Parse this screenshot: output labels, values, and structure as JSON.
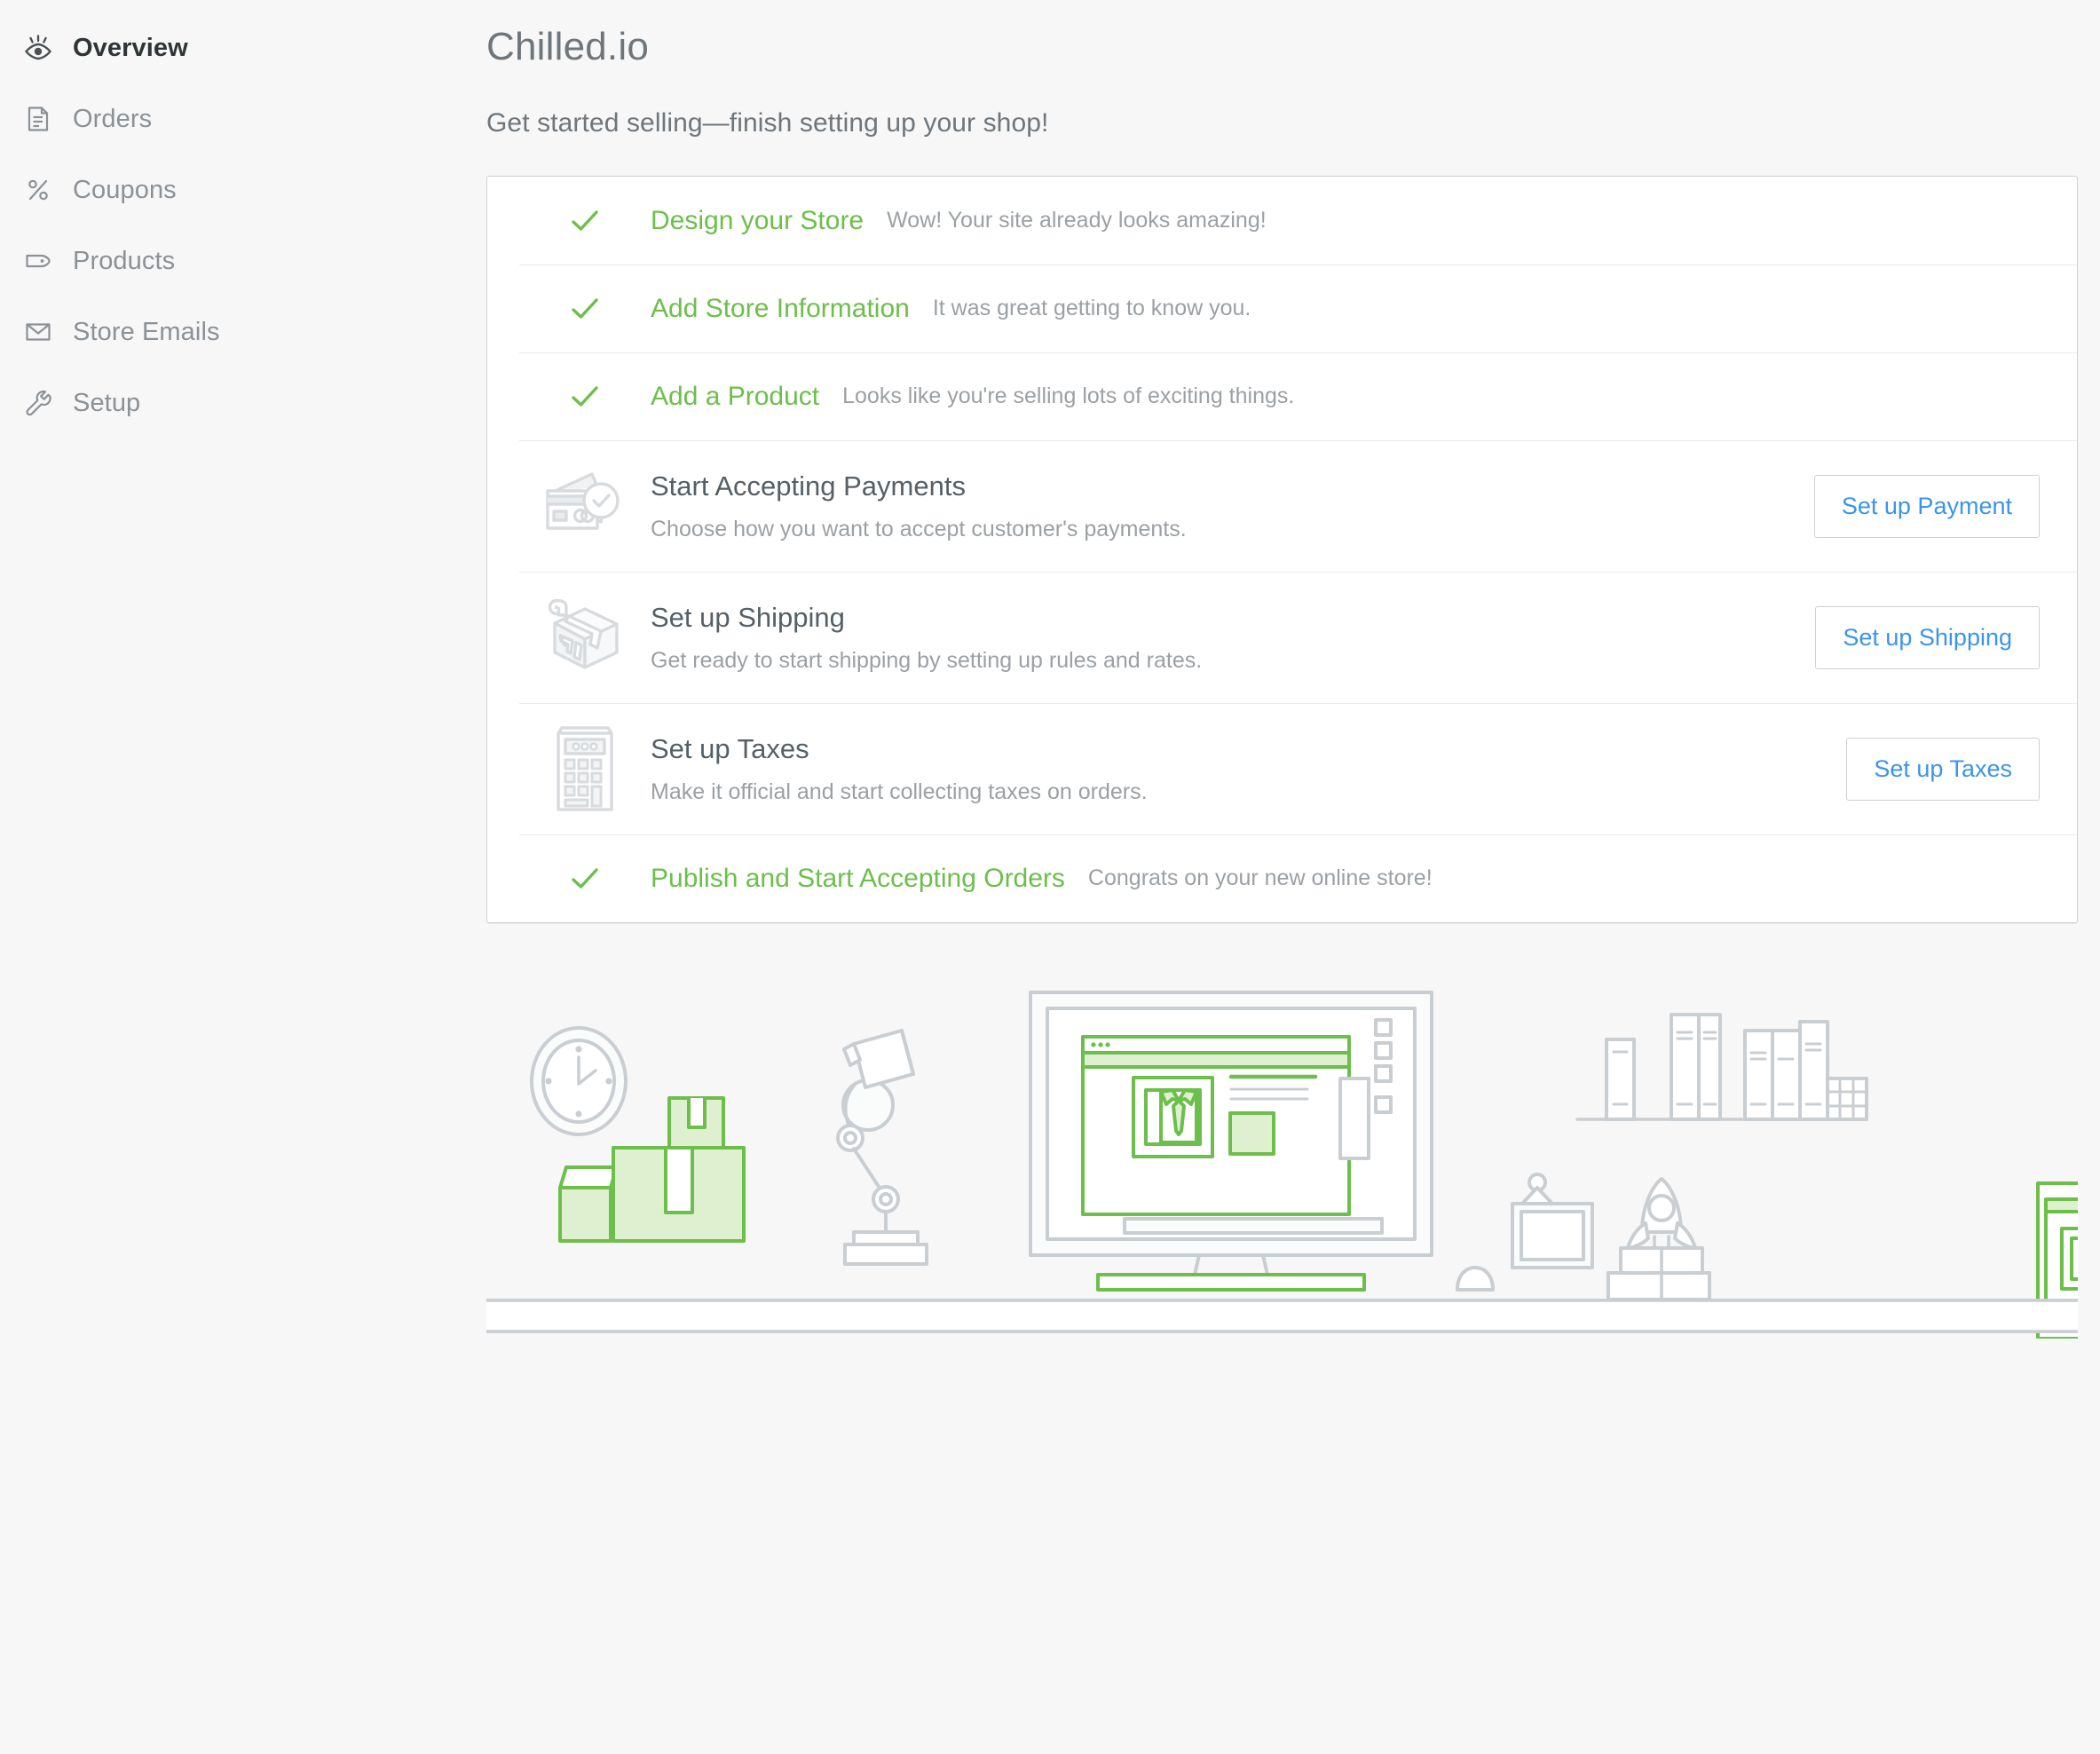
{
  "sidebar": {
    "items": [
      {
        "label": "Overview",
        "icon": "eye-icon",
        "active": true
      },
      {
        "label": "Orders",
        "icon": "document-icon",
        "active": false
      },
      {
        "label": "Coupons",
        "icon": "percent-icon",
        "active": false
      },
      {
        "label": "Products",
        "icon": "tag-icon",
        "active": false
      },
      {
        "label": "Store Emails",
        "icon": "envelope-icon",
        "active": false
      },
      {
        "label": "Setup",
        "icon": "wrench-icon",
        "active": false
      }
    ]
  },
  "header": {
    "title": "Chilled.io",
    "subtitle": "Get started selling—finish setting up your shop!"
  },
  "checklist": {
    "rows": [
      {
        "state": "done",
        "icon": "check-icon",
        "title": "Design your Store",
        "subtitle": "Wow! Your site already looks amazing!"
      },
      {
        "state": "done",
        "icon": "check-icon",
        "title": "Add Store Information",
        "subtitle": "It was great getting to know you."
      },
      {
        "state": "done",
        "icon": "check-icon",
        "title": "Add a Product",
        "subtitle": "Looks like you're selling lots of exciting things."
      },
      {
        "state": "todo",
        "icon": "credit-card-check-icon",
        "title": "Start Accepting Payments",
        "subtitle": "Choose how you want to accept customer's payments.",
        "button": "Set up Payment"
      },
      {
        "state": "todo",
        "icon": "shipping-box-icon",
        "title": "Set up Shipping",
        "subtitle": "Get ready to start shipping by setting up rules and rates.",
        "button": "Set up Shipping"
      },
      {
        "state": "todo",
        "icon": "calculator-icon",
        "title": "Set up Taxes",
        "subtitle": "Make it official and start collecting taxes on orders.",
        "button": "Set up Taxes"
      },
      {
        "state": "done",
        "icon": "check-icon",
        "title": "Publish and Start Accepting Orders",
        "subtitle": "Congrats on your new online store!"
      }
    ]
  },
  "illustration": {
    "name": "desk-workspace-illustration",
    "elements": [
      "wall-clock",
      "stacked-shipping-boxes",
      "desk-lamp",
      "desktop-monitor-with-store-page",
      "computer-mouse",
      "bookshelf-with-books",
      "tablet-with-product",
      "rocket-trophy",
      "picture-frame",
      "desk-surface"
    ]
  },
  "colors": {
    "accent_green": "#6cbf4b",
    "link_blue": "#3b94e8",
    "page_bg": "#f7f7f7",
    "panel_bg": "#ffffff",
    "border": "#ccd1d5",
    "muted_text": "#9ba0a4",
    "title_text": "#555f66"
  }
}
